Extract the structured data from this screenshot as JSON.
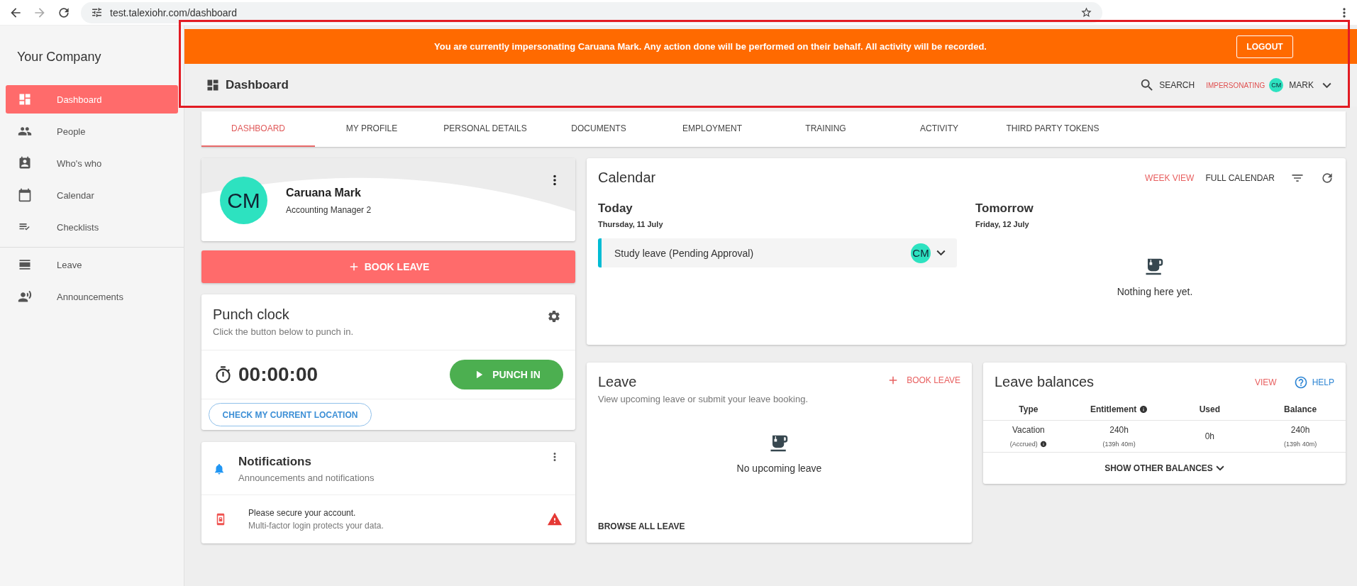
{
  "browser": {
    "url": "test.talexiohr.com/dashboard"
  },
  "sidebar": {
    "company": "Your Company",
    "sections": [
      {
        "items": [
          {
            "label": "Dashboard",
            "selected": true
          },
          {
            "label": "People",
            "selected": false
          },
          {
            "label": "Who's who",
            "selected": false
          },
          {
            "label": "Calendar",
            "selected": false
          },
          {
            "label": "Checklists",
            "selected": false
          }
        ]
      },
      {
        "items": [
          {
            "label": "Leave",
            "selected": false
          },
          {
            "label": "Announcements",
            "selected": false
          }
        ]
      }
    ]
  },
  "banner": {
    "text": "You are currently impersonating Caruana Mark. Any action done will be performed on their behalf. All activity will be recorded.",
    "button": "LOGOUT"
  },
  "header": {
    "title": "Dashboard",
    "search": "SEARCH",
    "impersonating": "IMPERSONATING",
    "user_initials": "CM",
    "user_name": "MARK"
  },
  "tabs": [
    {
      "label": "DASHBOARD",
      "selected": true
    },
    {
      "label": "MY PROFILE",
      "selected": false
    },
    {
      "label": "PERSONAL DETAILS",
      "selected": false
    },
    {
      "label": "DOCUMENTS",
      "selected": false
    },
    {
      "label": "EMPLOYMENT",
      "selected": false
    },
    {
      "label": "TRAINING",
      "selected": false
    },
    {
      "label": "ACTIVITY",
      "selected": false
    },
    {
      "label": "THIRD PARTY TOKENS",
      "selected": false
    }
  ],
  "profile": {
    "initials": "CM",
    "name": "Caruana Mark",
    "role": "Accounting Manager 2"
  },
  "book_leave_button": "BOOK LEAVE",
  "punch_clock": {
    "title": "Punch clock",
    "subtitle": "Click the button below to punch in.",
    "time": "00:00:00",
    "punch_button": "PUNCH IN",
    "location_button": "CHECK MY CURRENT LOCATION"
  },
  "notifications": {
    "title": "Notifications",
    "subtitle": "Announcements and notifications",
    "items": [
      {
        "title": "Please secure your account.",
        "text": "Multi-factor login protects your data."
      }
    ]
  },
  "calendar": {
    "title": "Calendar",
    "actions": [
      {
        "label": "WEEK VIEW",
        "selected": true
      },
      {
        "label": "FULL CALENDAR",
        "selected": false
      }
    ],
    "days": [
      {
        "title": "Today",
        "date": "Thursday, 11 July",
        "events": [
          {
            "label": "Study leave (Pending Approval)",
            "initials": "CM",
            "color": "#00bcd4"
          }
        ]
      },
      {
        "title": "Tomorrow",
        "date": "Friday, 12 July",
        "empty_text": "Nothing here yet."
      }
    ]
  },
  "leave": {
    "title": "Leave",
    "subtitle": "View upcoming leave or submit your leave booking.",
    "action": "BOOK LEAVE",
    "empty_text": "No upcoming leave",
    "browse": "BROWSE ALL LEAVE"
  },
  "leave_balances": {
    "title": "Leave balances",
    "view": "VIEW",
    "help": "HELP",
    "columns": [
      {
        "label": "Type",
        "info": false
      },
      {
        "label": "Entitlement",
        "info": true
      },
      {
        "label": "Used",
        "info": false
      },
      {
        "label": "Balance",
        "info": false
      }
    ],
    "rows": [
      {
        "cells": [
          {
            "value": "Vacation",
            "note": "(Accrued)",
            "info": true
          },
          {
            "value": "240h",
            "note": "(139h 40m)",
            "info": false
          },
          {
            "value": "0h",
            "info": false
          },
          {
            "value": "240h",
            "note": "(139h 40m)",
            "info": false
          }
        ]
      }
    ],
    "show_more": "SHOW OTHER BALANCES"
  }
}
